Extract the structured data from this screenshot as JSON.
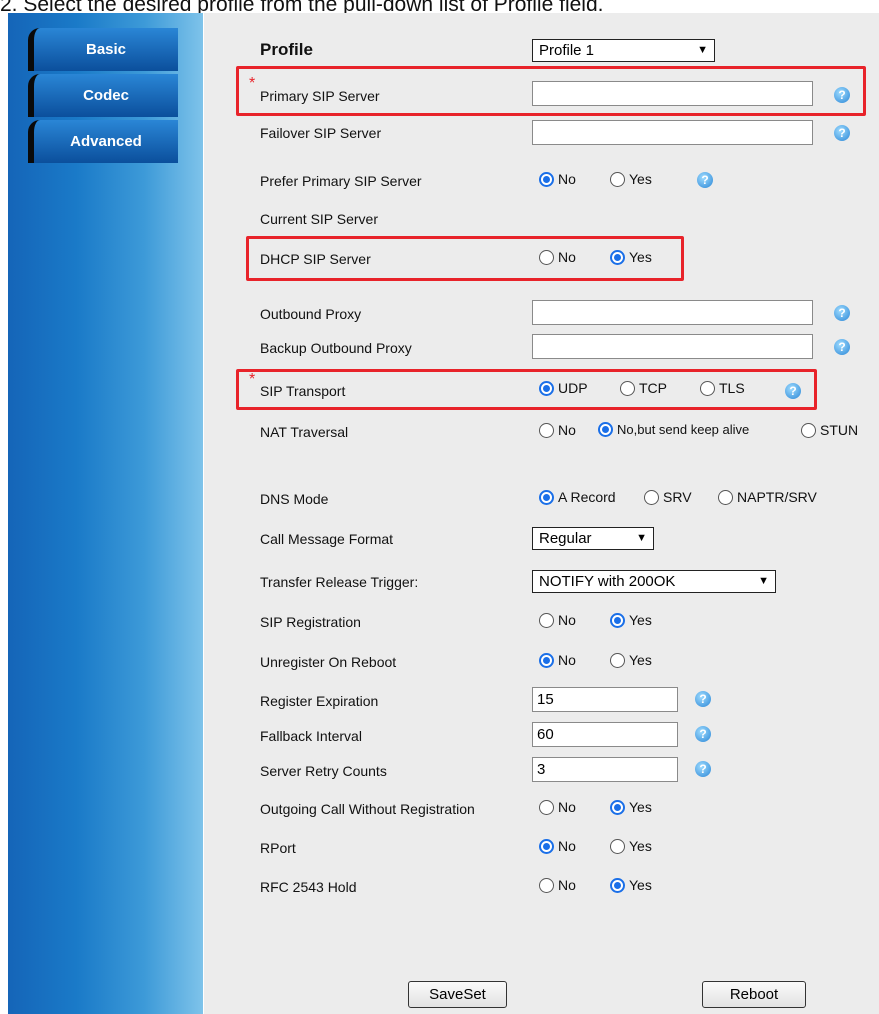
{
  "caption": "2. Select the desired profile from the pull-down list of Profile field.",
  "tabs": [
    "Basic",
    "Codec",
    "Advanced"
  ],
  "profile": {
    "label": "Profile",
    "value": "Profile 1"
  },
  "fields": {
    "primary_sip": {
      "label": "Primary SIP Server",
      "value": ""
    },
    "failover_sip": {
      "label": "Failover SIP Server",
      "value": ""
    },
    "prefer_primary": {
      "label": "Prefer Primary SIP Server",
      "options": [
        "No",
        "Yes"
      ],
      "selected": "No"
    },
    "current_sip": {
      "label": "Current SIP Server"
    },
    "dhcp_sip": {
      "label": "DHCP SIP Server",
      "options": [
        "No",
        "Yes"
      ],
      "selected": "Yes"
    },
    "outbound_proxy": {
      "label": "Outbound Proxy",
      "value": ""
    },
    "backup_outbound_proxy": {
      "label": "Backup Outbound Proxy",
      "value": ""
    },
    "sip_transport": {
      "label": "SIP Transport",
      "options": [
        "UDP",
        "TCP",
        "TLS"
      ],
      "selected": "UDP"
    },
    "nat_traversal": {
      "label": "NAT Traversal",
      "options": [
        "No",
        "No,but send keep alive",
        "STUN"
      ],
      "selected": "No,but send keep alive"
    },
    "dns_mode": {
      "label": "DNS Mode",
      "options": [
        "A Record",
        "SRV",
        "NAPTR/SRV"
      ],
      "selected": "A Record"
    },
    "call_message_format": {
      "label": "Call Message Format",
      "value": "Regular"
    },
    "transfer_release_trigger": {
      "label": "Transfer Release Trigger:",
      "value": "NOTIFY with 200OK"
    },
    "sip_registration": {
      "label": "SIP Registration",
      "options": [
        "No",
        "Yes"
      ],
      "selected": "Yes"
    },
    "unregister_on_reboot": {
      "label": "Unregister On Reboot",
      "options": [
        "No",
        "Yes"
      ],
      "selected": "No"
    },
    "register_expiration": {
      "label": "Register Expiration",
      "value": "15"
    },
    "fallback_interval": {
      "label": "Fallback Interval",
      "value": "60"
    },
    "server_retry_counts": {
      "label": "Server Retry Counts",
      "value": "3"
    },
    "outgoing_call_without_registration": {
      "label": "Outgoing Call Without Registration",
      "options": [
        "No",
        "Yes"
      ],
      "selected": "Yes"
    },
    "rport": {
      "label": "RPort",
      "options": [
        "No",
        "Yes"
      ],
      "selected": "No"
    },
    "rfc2543_hold": {
      "label": "RFC 2543 Hold",
      "options": [
        "No",
        "Yes"
      ],
      "selected": "Yes"
    }
  },
  "help_glyph": "?",
  "required_mark": "*",
  "buttons": {
    "save": "SaveSet",
    "reboot": "Reboot"
  },
  "colors": {
    "highlight": "#e8232a",
    "accent": "#1a6fe8",
    "sidebar": "#1a7ac8"
  }
}
